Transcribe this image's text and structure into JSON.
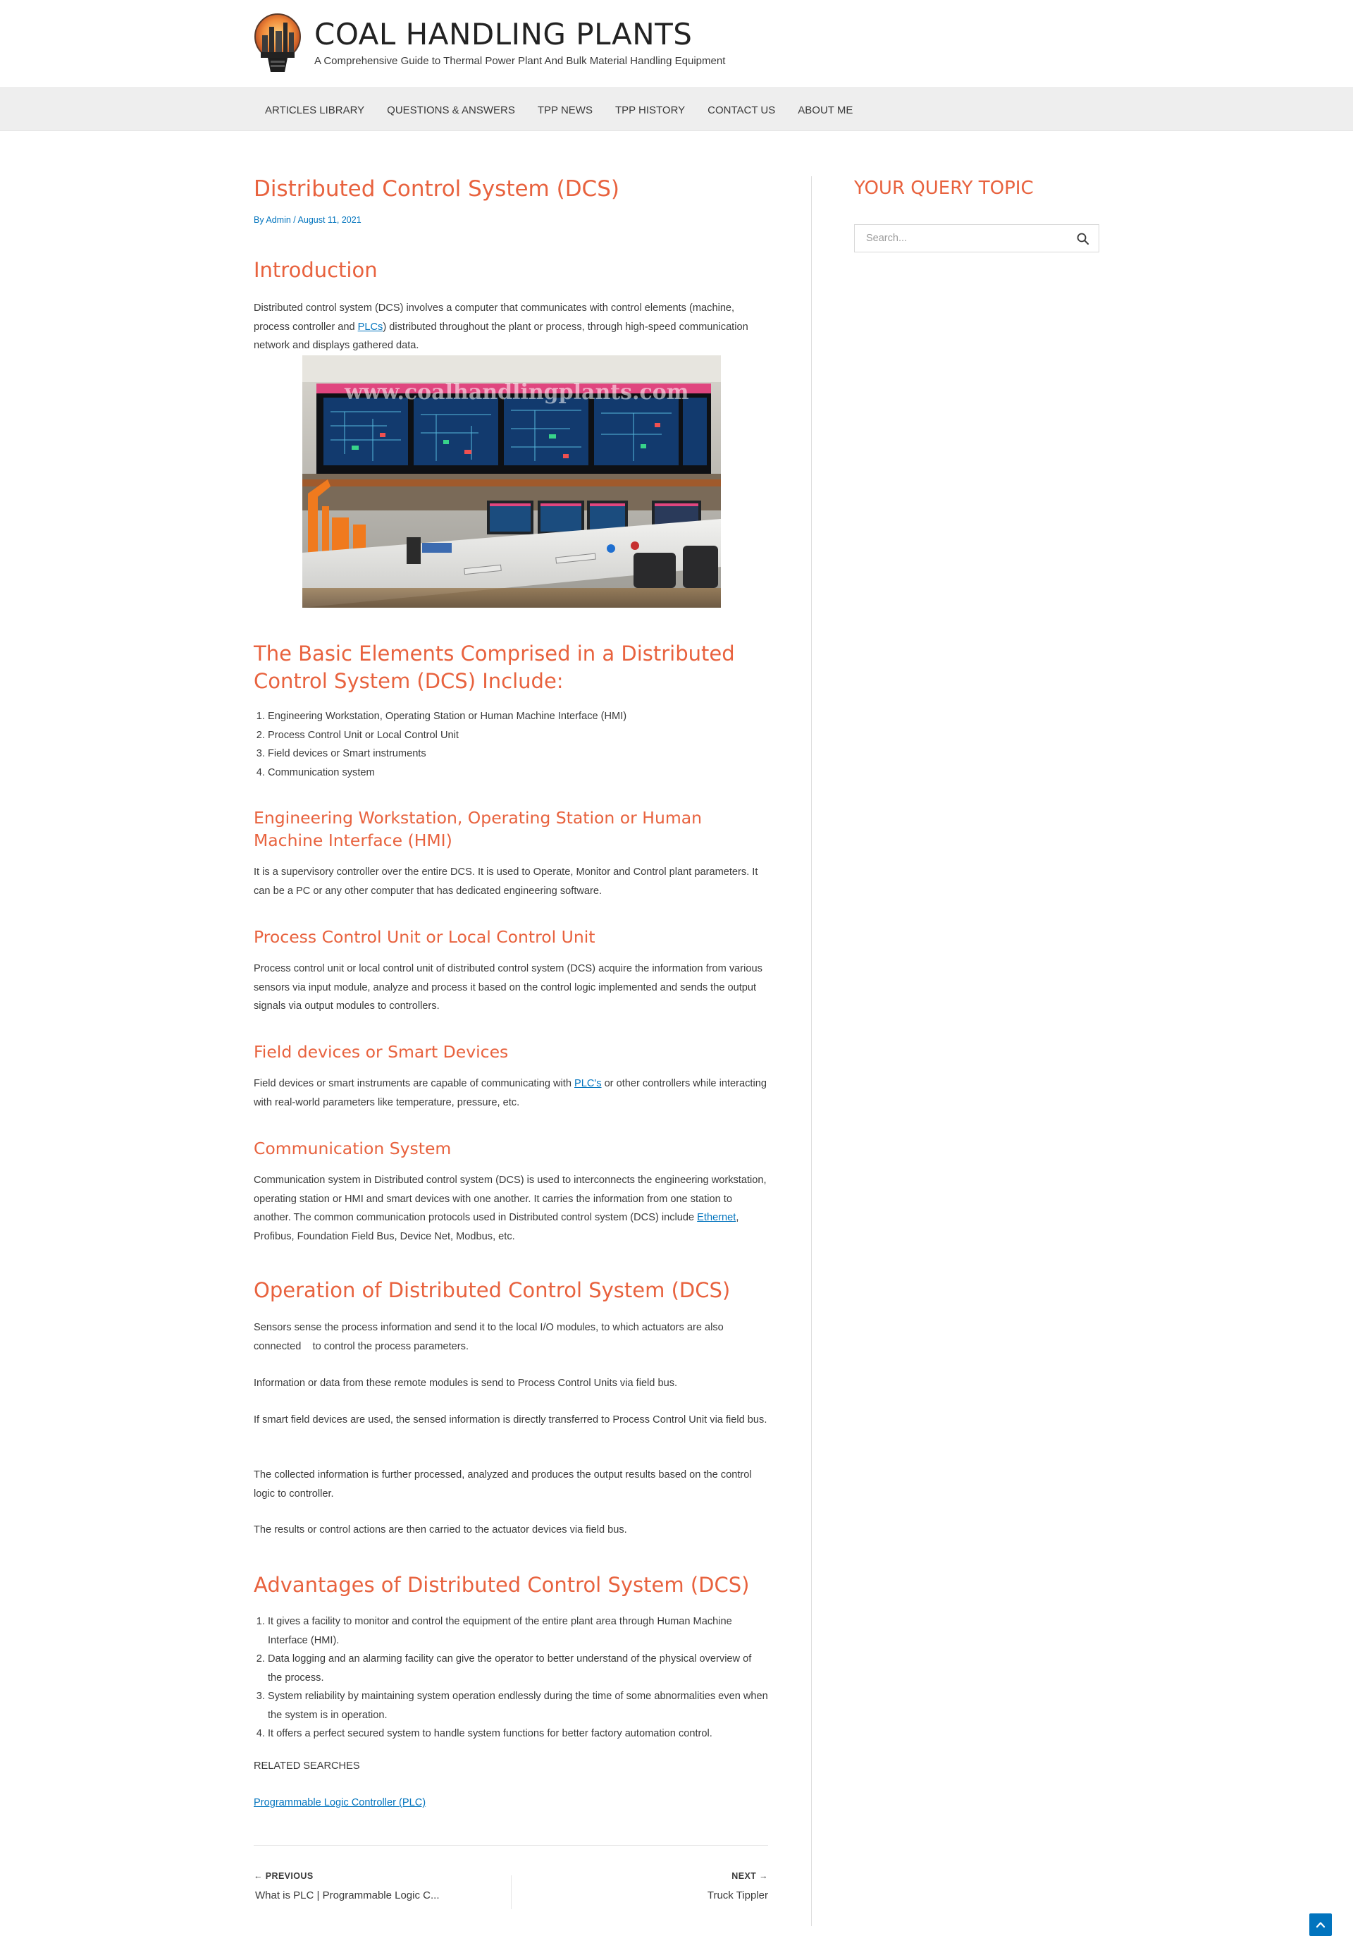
{
  "site": {
    "title": "COAL HANDLING PLANTS",
    "tagline": "A Comprehensive Guide to Thermal Power Plant And Bulk Material Handling Equipment"
  },
  "nav": [
    {
      "label": "ARTICLES LIBRARY"
    },
    {
      "label": "QUESTIONS & ANSWERS"
    },
    {
      "label": "TPP NEWS"
    },
    {
      "label": "TPP HISTORY"
    },
    {
      "label": "CONTACT US"
    },
    {
      "label": "ABOUT ME"
    }
  ],
  "article": {
    "title": "Distributed Control System (DCS)",
    "meta": {
      "by": "By ",
      "author": "Admin",
      "sep": " / ",
      "date": "August 11, 2021"
    },
    "intro_heading": "Introduction",
    "intro": {
      "pre": "Distributed control system (DCS) involves a computer that communicates with control elements (machine, process controller and ",
      "link": "PLCs",
      "post": ") distributed throughout the plant or process, through high-speed communication network and displays gathered data."
    },
    "image": {
      "watermark": "www.coalhandlingplants.com"
    },
    "elements_heading": "The Basic Elements Comprised in a Distributed Control System (DCS) Include:",
    "elements": [
      "Engineering Workstation, Operating Station or Human Machine Interface (HMI)",
      "Process Control Unit or Local Control Unit",
      "Field devices or Smart instruments",
      "Communication system"
    ],
    "hmi_heading": "Engineering Workstation, Operating Station or Human Machine Interface (HMI)",
    "hmi_text": "It is a supervisory controller over the entire DCS. It is used to Operate, Monitor and Control plant parameters. It can be a PC or any other computer that has dedicated engineering software.",
    "pcu_heading": "Process Control Unit or Local Control Unit",
    "pcu_text": "Process control unit or local control unit of distributed control system (DCS) acquire the information from various sensors via input module, analyze and process it based on the control logic implemented and sends the output signals via output modules to controllers.",
    "field_heading": "Field devices or Smart Devices",
    "field_text": {
      "pre": "Field devices or smart instruments are capable of communicating with ",
      "link": "PLC's",
      "post": " or other controllers while interacting with real-world parameters like temperature, pressure, etc."
    },
    "comm_heading": "Communication System",
    "comm_text": {
      "pre": "Communication system in Distributed control system (DCS) is used to interconnects the engineering workstation, operating station or HMI and smart devices with one another. It carries the information from one station to another. The common communication protocols used in Distributed control system (DCS) include ",
      "link": "Ethernet",
      "post": ", Profibus, Foundation Field Bus, Device Net, Modbus, etc."
    },
    "operation_heading": "Operation of Distributed Control System (DCS)",
    "operation_paragraphs": [
      "Sensors sense the process information and send it to the local I/O modules, to which actuators are also connected    to control the process parameters.",
      "Information or data from these remote modules is send to Process Control Units via field bus.",
      "If smart field devices are used, the sensed information is directly transferred to Process Control Unit via field bus.",
      "The collected information is further processed, analyzed and produces the output results based on the control logic to controller.",
      "The results or control actions are then carried to the actuator devices via field bus."
    ],
    "advantages_heading": "Advantages of Distributed Control System (DCS)",
    "advantages": [
      "It gives a facility to monitor and control the equipment of the entire plant area through Human Machine Interface (HMI).",
      "Data logging and an alarming facility can give the operator to better understand of the physical overview of the process.",
      "System reliability by maintaining system operation endlessly during the time of some abnormalities even when the system is in operation.",
      "It offers a perfect secured system to handle system functions for better factory automation control."
    ],
    "related_label": "RELATED SEARCHES",
    "related_link": "Programmable Logic Controller (PLC)"
  },
  "post_nav": {
    "prev_label": "PREVIOUS",
    "prev_title": "What is PLC | Programmable Logic C...",
    "next_label": "NEXT",
    "next_title": "Truck Tippler"
  },
  "sidebar": {
    "widget_title": "YOUR QUERY TOPIC",
    "search_placeholder": "Search..."
  },
  "colors": {
    "heading": "#e8623e",
    "link": "#0274be",
    "text": "#3a3a3a",
    "nav_bg": "#eeeeee"
  }
}
